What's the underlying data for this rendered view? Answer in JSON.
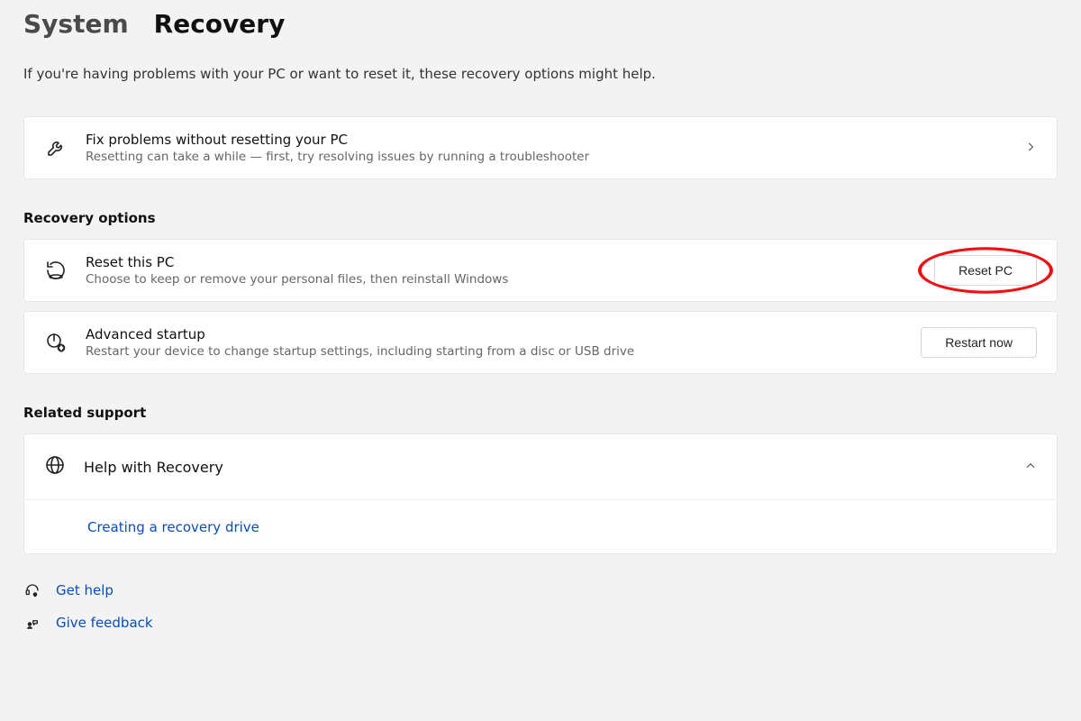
{
  "breadcrumb": {
    "parent": "System",
    "current": "Recovery"
  },
  "intro": "If you're having problems with your PC or want to reset it, these recovery options might help.",
  "fix_card": {
    "title": "Fix problems without resetting your PC",
    "desc": "Resetting can take a while — first, try resolving issues by running a troubleshooter"
  },
  "recovery_heading": "Recovery options",
  "reset_card": {
    "title": "Reset this PC",
    "desc": "Choose to keep or remove your personal files, then reinstall Windows",
    "button": "Reset PC"
  },
  "advanced_card": {
    "title": "Advanced startup",
    "desc": "Restart your device to change startup settings, including starting from a disc or USB drive",
    "button": "Restart now"
  },
  "support_heading": "Related support",
  "support_row": {
    "title": "Help with Recovery"
  },
  "support_link": "Creating a recovery drive",
  "footer": {
    "get_help": "Get help",
    "give_feedback": "Give feedback"
  }
}
